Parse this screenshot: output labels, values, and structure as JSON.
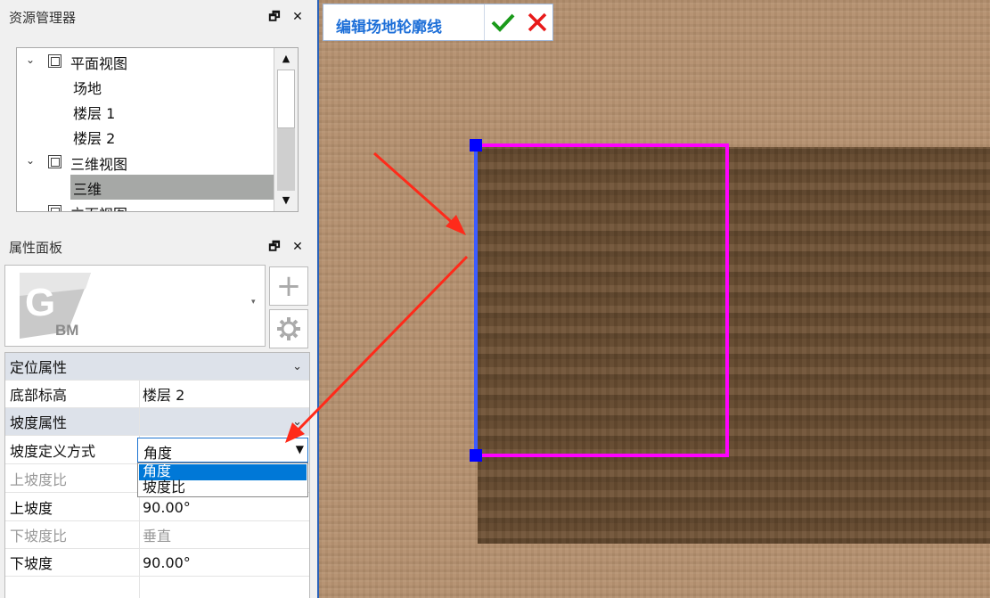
{
  "explorer": {
    "title": "资源管理器",
    "float_icon": "float-window-icon",
    "close_icon": "close-icon",
    "tree": [
      {
        "label": "平面视图",
        "type": "group",
        "expanded": true
      },
      {
        "label": "场地",
        "type": "item"
      },
      {
        "label": "楼层 1",
        "type": "item"
      },
      {
        "label": "楼层 2",
        "type": "item"
      },
      {
        "label": "三维视图",
        "type": "group",
        "expanded": true
      },
      {
        "label": "三维",
        "type": "item",
        "selected": true
      },
      {
        "label": "立面视图",
        "type": "group",
        "expanded": true
      }
    ]
  },
  "properties": {
    "title": "属性面板",
    "logo_text": "GBM",
    "rows": [
      {
        "key": "定位属性",
        "group": true
      },
      {
        "key": "底部标高",
        "value": "楼层 2"
      },
      {
        "key": "坡度属性",
        "group": true
      },
      {
        "key": "坡度定义方式",
        "value": "角度"
      },
      {
        "key": "上坡度比",
        "value": "",
        "disabled": true
      },
      {
        "key": "上坡度",
        "value": "90.00°"
      },
      {
        "key": "下坡度比",
        "value": "垂直",
        "disabled": true
      },
      {
        "key": "下坡度",
        "value": "90.00°"
      }
    ],
    "dropdown": {
      "selected": "角度",
      "options": [
        "角度",
        "坡度比"
      ],
      "highlighted": "角度"
    }
  },
  "viewport": {
    "mode_title": "编辑场地轮廓线",
    "confirm_icon": "check-icon",
    "cancel_icon": "x-icon",
    "colors": {
      "outline": "#ff00ff",
      "active_edge": "#3b5bff",
      "handle": "#0000ff",
      "arrow": "#ff2a1a"
    }
  }
}
